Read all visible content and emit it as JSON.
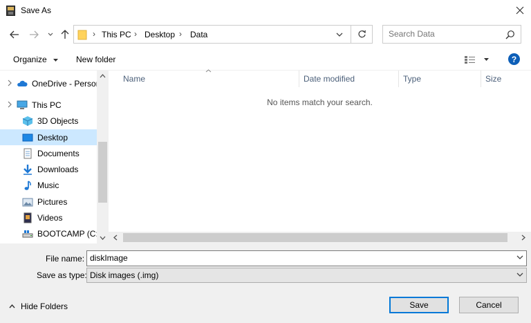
{
  "window": {
    "title": "Save As"
  },
  "breadcrumb": [
    "This PC",
    "Desktop",
    "Data"
  ],
  "search": {
    "placeholder": "Search Data"
  },
  "toolbar": {
    "organize_label": "Organize",
    "new_folder_label": "New folder",
    "help_label": "?"
  },
  "sidebar": {
    "items": [
      {
        "label": "OneDrive - Person",
        "icon": "cloud-icon"
      },
      {
        "label": "This PC",
        "icon": "computer-icon"
      },
      {
        "label": "3D Objects",
        "icon": "cube-icon"
      },
      {
        "label": "Desktop",
        "icon": "desktop-icon",
        "selected": true
      },
      {
        "label": "Documents",
        "icon": "document-icon"
      },
      {
        "label": "Downloads",
        "icon": "download-icon"
      },
      {
        "label": "Music",
        "icon": "music-icon"
      },
      {
        "label": "Pictures",
        "icon": "picture-icon"
      },
      {
        "label": "Videos",
        "icon": "video-icon"
      },
      {
        "label": "BOOTCAMP (C:)",
        "icon": "drive-icon"
      }
    ]
  },
  "columns": [
    "Name",
    "Date modified",
    "Type",
    "Size"
  ],
  "content": {
    "empty_message": "No items match your search."
  },
  "form": {
    "file_name_label": "File name:",
    "file_name_value": "diskImage",
    "save_as_type_label": "Save as type:",
    "save_as_type_value": "Disk images (.img)"
  },
  "footer": {
    "hide_folders_label": "Hide Folders",
    "save_label": "Save",
    "cancel_label": "Cancel"
  },
  "colors": {
    "accent": "#0078d7",
    "selected": "#cce8ff",
    "help": "#0d5fb8"
  }
}
